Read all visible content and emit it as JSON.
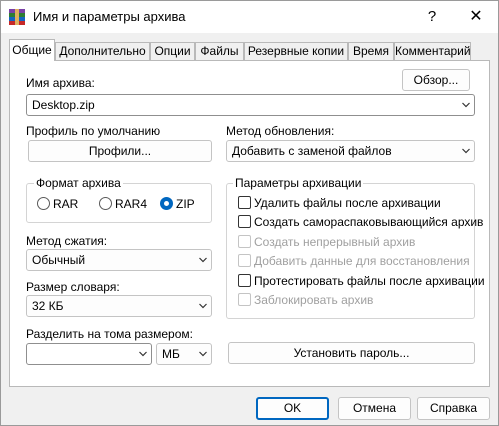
{
  "window": {
    "title": "Имя и параметры архива",
    "help_glyph": "?",
    "close_glyph": "✕"
  },
  "tabs": [
    {
      "label": "Общие",
      "active": true
    },
    {
      "label": "Дополнительно"
    },
    {
      "label": "Опции"
    },
    {
      "label": "Файлы"
    },
    {
      "label": "Резервные копии"
    },
    {
      "label": "Время"
    },
    {
      "label": "Комментарий"
    }
  ],
  "archive": {
    "name_label": "Имя архива:",
    "name_value": "Desktop.zip",
    "browse_label": "Обзор..."
  },
  "profile": {
    "label": "Профиль по умолчанию",
    "button_label": "Профили..."
  },
  "update_method": {
    "label": "Метод обновления:",
    "value": "Добавить с заменой файлов"
  },
  "format": {
    "title": "Формат архива",
    "options": [
      {
        "label": "RAR",
        "selected": false
      },
      {
        "label": "RAR4",
        "selected": false
      },
      {
        "label": "ZIP",
        "selected": true
      }
    ]
  },
  "compression": {
    "label": "Метод сжатия:",
    "value": "Обычный"
  },
  "dictionary": {
    "label": "Размер словаря:",
    "value": "32 КБ"
  },
  "split": {
    "label": "Разделить на тома размером:",
    "value": "",
    "unit": "МБ"
  },
  "options": {
    "title": "Параметры архивации",
    "items": [
      {
        "label": "Удалить файлы после архивации",
        "checked": false,
        "enabled": true
      },
      {
        "label": "Создать самораспаковывающийся архив",
        "checked": false,
        "enabled": true
      },
      {
        "label": "Создать непрерывный архив",
        "checked": false,
        "enabled": false
      },
      {
        "label": "Добавить данные для восстановления",
        "checked": false,
        "enabled": false
      },
      {
        "label": "Протестировать файлы после архивации",
        "checked": false,
        "enabled": true
      },
      {
        "label": "Заблокировать архив",
        "checked": false,
        "enabled": false
      }
    ]
  },
  "password_button": "Установить пароль...",
  "footer": {
    "ok": "OK",
    "cancel": "Отмена",
    "help": "Справка"
  },
  "colors": {
    "accent": "#0067c0",
    "disabled_text": "#a0a0a0"
  }
}
